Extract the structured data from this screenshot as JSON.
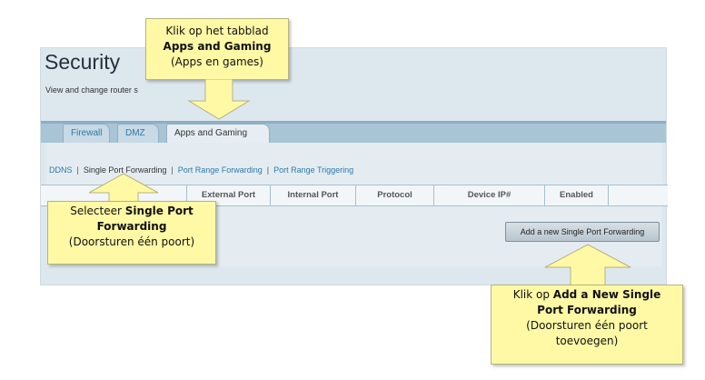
{
  "page": {
    "title": "Security",
    "subtitle": "View and change router s"
  },
  "tabs": [
    {
      "label": "Firewall",
      "active": false
    },
    {
      "label": "DMZ",
      "active": false
    },
    {
      "label": "Apps and Gaming",
      "active": true
    }
  ],
  "subnav": {
    "items": [
      {
        "label": "DDNS",
        "current": false
      },
      {
        "label": "Single Port Forwarding",
        "current": true
      },
      {
        "label": "Port Range Forwarding",
        "current": false
      },
      {
        "label": "Port Range Triggering",
        "current": false
      }
    ],
    "separator": "|"
  },
  "table": {
    "headers": [
      "External Port",
      "Internal Port",
      "Protocol",
      "Device IP#",
      "Enabled"
    ]
  },
  "buttons": {
    "add_label": "Add a new Single Port Forwarding"
  },
  "callouts": {
    "apps": {
      "line1": "Klik op het tabblad",
      "bold": "Apps and Gaming",
      "line3": "(Apps en games)"
    },
    "single": {
      "prefix": "Selecteer ",
      "bold1": "Single Port",
      "bold2": "Forwarding",
      "line3": "(Doorsturen één poort)"
    },
    "add": {
      "prefix": "Klik op ",
      "bold1": "Add a New Single",
      "bold2": "Port Forwarding",
      "line3": "(Doorsturen één poort",
      "line4": "toevoegen)"
    }
  },
  "colors": {
    "callout_fill": "#fff9a6",
    "link": "#2e7aa8",
    "panel": "#dde7ee",
    "tabbar": "#a9c4d4"
  }
}
